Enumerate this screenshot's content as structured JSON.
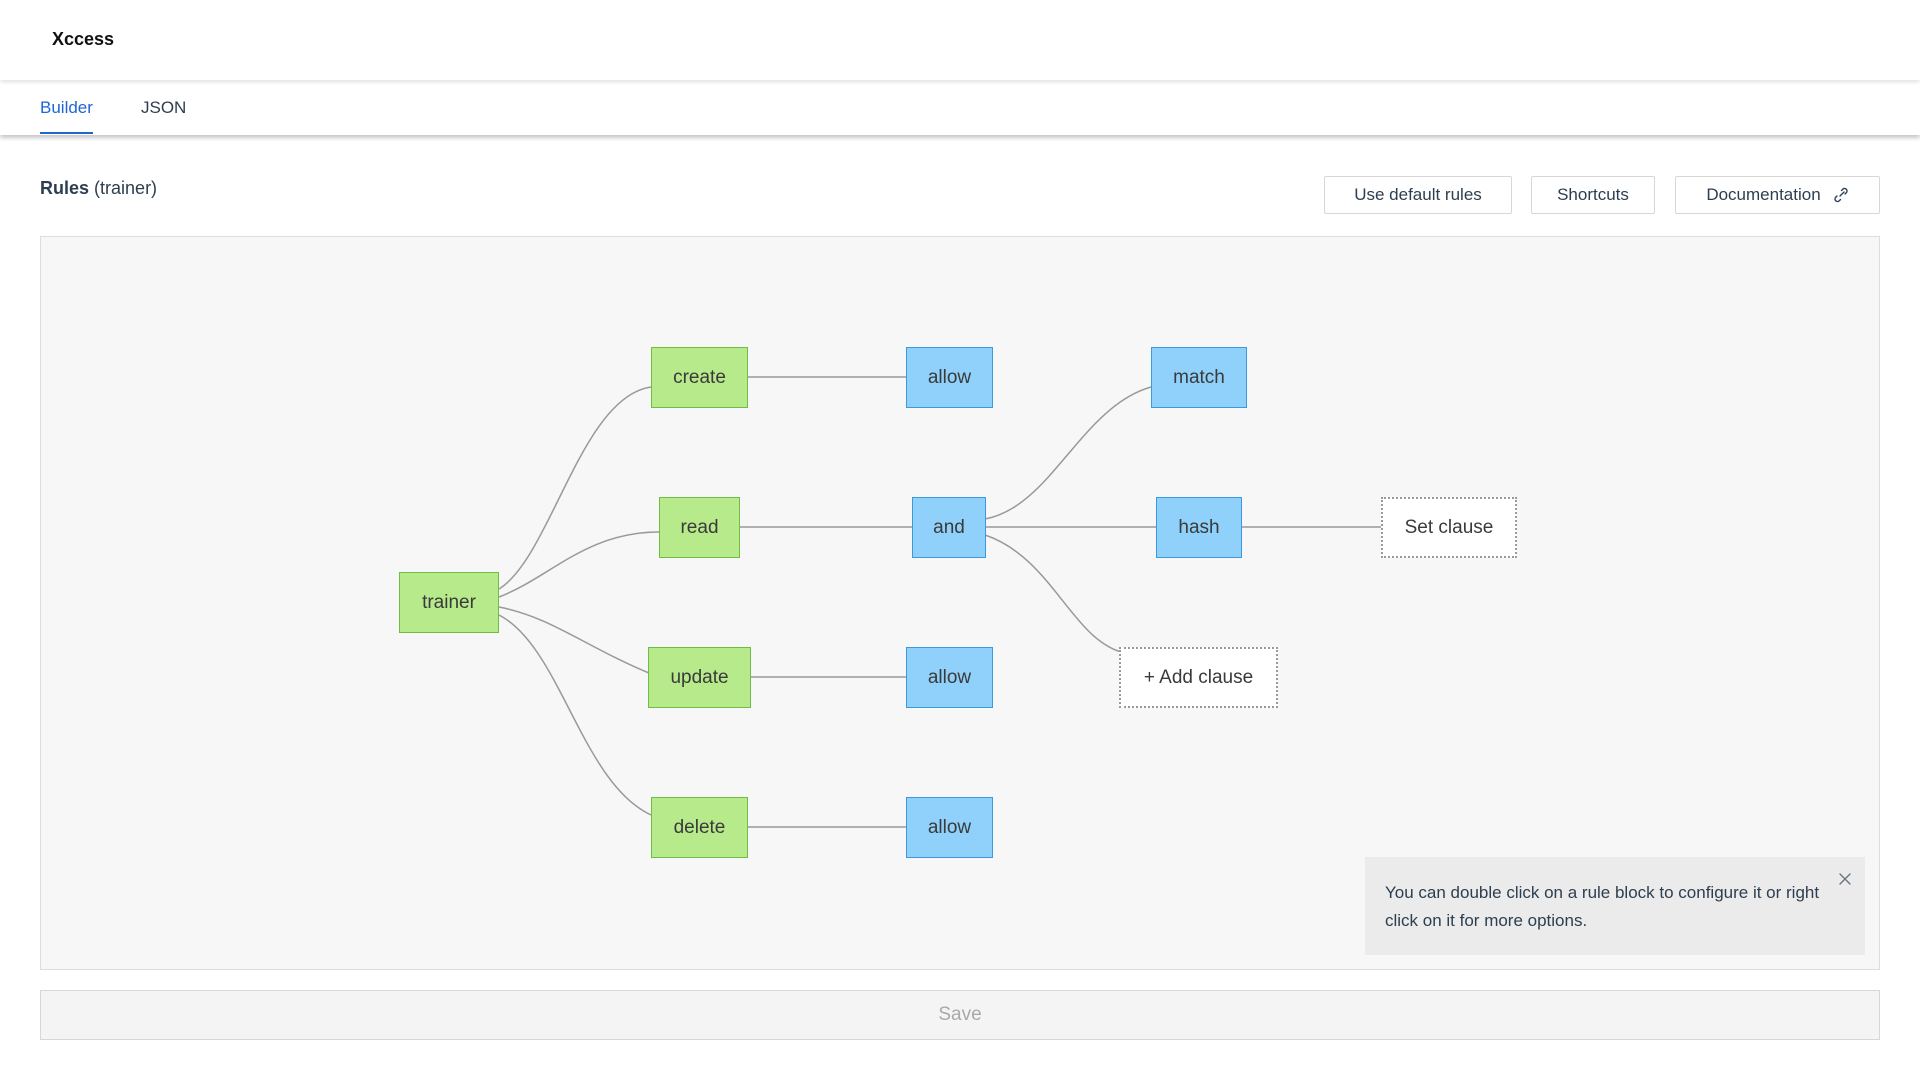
{
  "app": {
    "title": "Xccess"
  },
  "tabs": [
    {
      "label": "Builder"
    },
    {
      "label": "JSON"
    }
  ],
  "rules": {
    "title": "Rules",
    "role": "(trainer)"
  },
  "toolbar": {
    "default_label": "Use default rules",
    "shortcuts_label": "Shortcuts",
    "docs_label": "Documentation"
  },
  "tree": {
    "root": "trainer",
    "operations": [
      "create",
      "read",
      "update",
      "delete"
    ],
    "create_action": "allow",
    "read_condition": "and",
    "update_action": "allow",
    "delete_action": "allow",
    "clauses": [
      "match",
      "hash"
    ],
    "set_clause": "Set clause",
    "add_clause": "+ Add clause"
  },
  "hint": {
    "text": "You can double click on a rule block to configure it or right click on it for more options."
  },
  "save_label": "Save",
  "colors": {
    "accent": "#1e66d0",
    "node_green": "#b7ea8b",
    "node_blue": "#8fd1fb",
    "canvas_bg": "#f7f7f7"
  }
}
